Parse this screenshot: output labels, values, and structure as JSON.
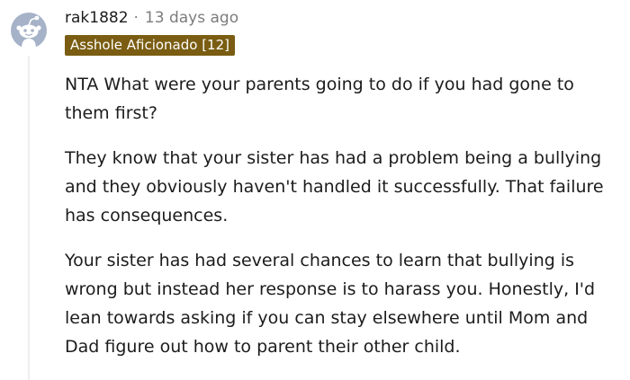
{
  "comment": {
    "username": "rak1882",
    "separator": "·",
    "timestamp": "13 days ago",
    "flair": "Asshole Aficionado [12]",
    "paragraphs": [
      "NTA What were your parents going to do if you had gone to them first?",
      "They know that your sister has had a problem being a bullying and they obviously haven't handled it successfully. That failure has consequences.",
      "Your sister has had several chances to learn that bullying is wrong but instead her response is to harass you. Honestly, I'd lean towards asking if you can stay elsewhere until Mom and Dad figure out how to parent their other child."
    ]
  },
  "colors": {
    "avatar_bg": "#a5b2c8",
    "avatar_robot": "#ffffff",
    "flair_bg": "#7a5d12",
    "flair_text": "#ffffff",
    "text": "#1c1c1c",
    "meta_text": "#7c7c7c",
    "thread_line": "#edeff1"
  },
  "icons": {
    "avatar": "snoo-avatar-icon"
  }
}
